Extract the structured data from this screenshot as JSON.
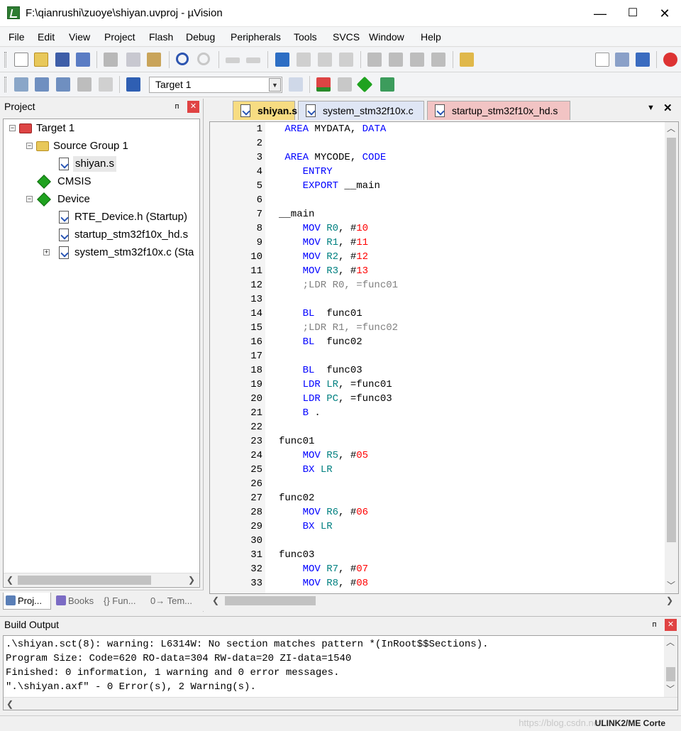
{
  "window": {
    "title": "F:\\qianrushi\\zuoye\\shiyan.uvproj - µVision",
    "minimize": "—",
    "maximize": "☐",
    "close": "✕"
  },
  "menu": [
    "File",
    "Edit",
    "View",
    "Project",
    "Flash",
    "Debug",
    "Peripherals",
    "Tools",
    "SVCS",
    "Window",
    "Help"
  ],
  "toolbar2": {
    "target": "Target 1"
  },
  "project": {
    "title": "Project",
    "pin": "ᴨ",
    "close": "✕",
    "tree": {
      "target": "Target 1",
      "group": "Source Group 1",
      "file1": "shiyan.s",
      "cmsis": "CMSIS",
      "device": "Device",
      "dev1": "RTE_Device.h (Startup)",
      "dev2": "startup_stm32f10x_hd.s",
      "dev3": "system_stm32f10x.c (Sta"
    },
    "tabs": [
      "Proj...",
      "Books",
      "{} Fun...",
      "0→ Tem..."
    ]
  },
  "editor": {
    "tabs": [
      "shiyan.s",
      "system_stm32f10x.c",
      "startup_stm32f10x_hd.s"
    ],
    "tab_colors": [
      "#f7dc82",
      "#dfe6f5",
      "#f2c4c4"
    ],
    "menu_arrow": "▼",
    "close": "✕",
    "line_numbers": [
      "1",
      "2",
      "3",
      "4",
      "5",
      "6",
      "7",
      "8",
      "9",
      "10",
      "11",
      "12",
      "13",
      "14",
      "15",
      "16",
      "17",
      "18",
      "19",
      "20",
      "21",
      "22",
      "23",
      "24",
      "25",
      "26",
      "27",
      "28",
      "29",
      "30",
      "31",
      "32",
      "33"
    ],
    "lines": [
      " AREA MYDATA, DATA",
      "",
      " AREA MYCODE, CODE",
      "    ENTRY",
      "    EXPORT __main",
      "",
      "__main",
      "    MOV R0, #10",
      "    MOV R1, #11",
      "    MOV R2, #12",
      "    MOV R3, #13",
      "    ;LDR R0, =func01",
      "",
      "    BL  func01",
      "    ;LDR R1, =func02",
      "    BL  func02",
      "",
      "    BL  func03",
      "    LDR LR, =func01",
      "    LDR PC, =func03",
      "    B .",
      "",
      "func01",
      "    MOV R5, #05",
      "    BX LR",
      "",
      "func02",
      "    MOV R6, #06",
      "    BX LR",
      "",
      "func03",
      "    MOV R7, #07",
      "    MOV R8, #08"
    ]
  },
  "build": {
    "title": "Build Output",
    "pin": "ᴨ",
    "close": "✕",
    "lines": [
      ".\\shiyan.sct(8): warning: L6314W: No section matches pattern *(InRoot$$Sections).",
      "Program Size: Code=620 RO-data=304 RW-data=20 ZI-data=1540",
      "Finished: 0 information, 1 warning and 0 error messages.",
      "\".\\shiyan.axf\" - 0 Error(s), 2 Warning(s)."
    ]
  },
  "status": {
    "debugger": "ULINK2/ME Corte",
    "watermark": "https://blog.csdn.net/..."
  },
  "icons": {
    "keyword_color": "#0000ff",
    "register_color": "#008080",
    "number_color": "#ff0000",
    "comment_color": "#808080"
  }
}
